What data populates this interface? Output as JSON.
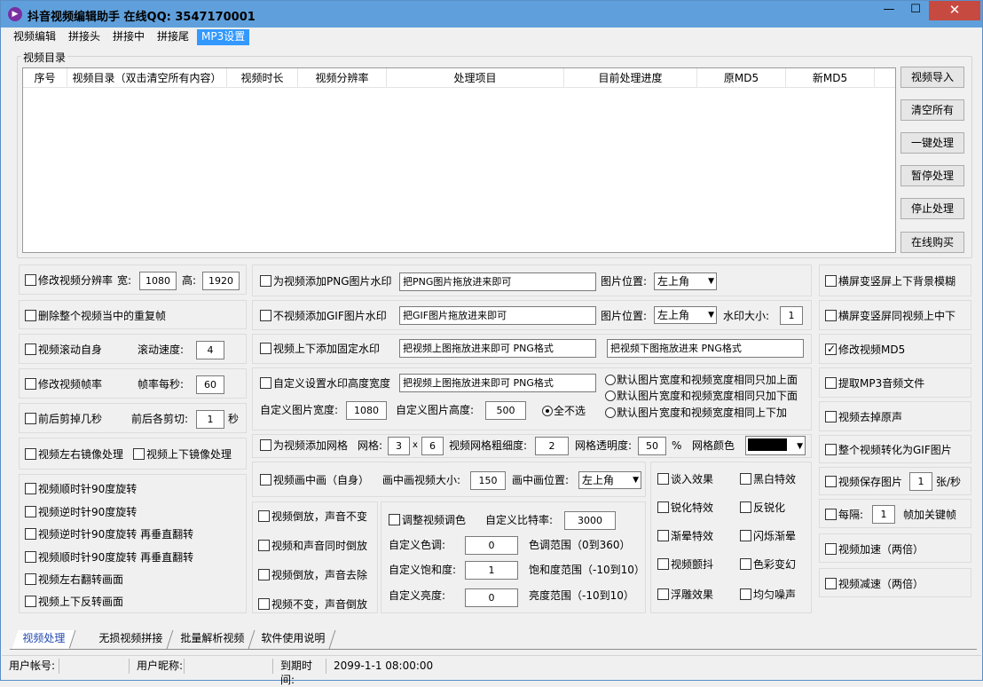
{
  "window": {
    "title": "抖音视频编辑助手  在线QQ: 3547170001",
    "icon": "play-icon",
    "min": "—",
    "max": "☐",
    "close": "✕"
  },
  "menu": [
    "视频编辑",
    "拼接头",
    "拼接中",
    "拼接尾",
    "MP3设置"
  ],
  "video_list": {
    "group_title": "视频目录",
    "columns": [
      "序号",
      "视频目录（双击清空所有内容）",
      "视频时长",
      "视频分辨率",
      "处理项目",
      "目前处理进度",
      "原MD5",
      "新MD5"
    ]
  },
  "side_buttons": [
    "视频导入",
    "清空所有",
    "一键处理",
    "暂停处理",
    "停止处理",
    "在线购买"
  ],
  "left": {
    "resolution": {
      "label": "修改视频分辨率",
      "w_label": "宽:",
      "w": "1080",
      "h_label": "高:",
      "h": "1920"
    },
    "dedupe": "删除整个视频当中的重复帧",
    "scroll": {
      "label": "视频滚动自身",
      "speed_label": "滚动速度:",
      "speed": "4"
    },
    "fps": {
      "label": "修改视频帧率",
      "per_label": "帧率每秒:",
      "value": "60"
    },
    "trim": {
      "label": "前后剪掉几秒",
      "each_label": "前后各剪切:",
      "value": "1",
      "unit": "秒"
    },
    "mirror_lr": "视频左右镜像处理",
    "mirror_ud": "视频上下镜像处理",
    "rotations": [
      "视频顺时针90度旋转",
      "视频逆时针90度旋转",
      "视频逆时针90度旋转 再垂直翻转",
      "视频顺时针90度旋转 再垂直翻转",
      "视频左右翻转画面",
      "视频上下反转画面"
    ]
  },
  "center": {
    "png": {
      "label": "为视频添加PNG图片水印",
      "input": "把PNG图片拖放进来即可",
      "pos_label": "图片位置:",
      "pos": "左上角"
    },
    "gif": {
      "label": "不视频添加GIF图片水印",
      "input": "把GIF图片拖放进来即可",
      "pos_label": "图片位置:",
      "pos": "左上角",
      "size_label": "水印大小:",
      "size": "1"
    },
    "updown": {
      "label": "视频上下添加固定水印",
      "top": "把视频上图拖放进来即可 PNG格式",
      "bottom": "把视频下图拖放进来  PNG格式"
    },
    "custom": {
      "label": "自定义设置水印高度宽度",
      "input": "把视频上图拖放进来即可 PNG格式",
      "w_label": "自定义图片宽度:",
      "w": "1080",
      "h_label": "自定义图片高度:",
      "h": "500",
      "none": "全不选",
      "radios": [
        "默认图片宽度和视频宽度相同只加上面",
        "默认图片宽度和视频宽度相同只加下面",
        "默认图片宽度和视频宽度相同上下加"
      ]
    },
    "grid": {
      "label": "为视频添加网格",
      "grid_label": "网格:",
      "a": "3",
      "x": "x",
      "b": "6",
      "thick_label": "视频网格粗细度:",
      "thick": "2",
      "alpha_label": "网格透明度:",
      "alpha": "50",
      "pct": "%",
      "color_label": "网格颜色",
      "color": "#000000"
    },
    "pip": {
      "label": "视频画中画（自身）",
      "size_label": "画中画视频大小:",
      "size": "150",
      "pos_label": "画中画位置:",
      "pos": "左上角"
    },
    "reverse": [
      "视频倒放，声音不变",
      "视频和声音同时倒放",
      "视频倒放，声音去除",
      "视频不变，声音倒放"
    ],
    "color": {
      "label": "调整视频调色",
      "bitrate_label": "自定义比特率:",
      "bitrate": "3000",
      "hue_label": "自定义色调:",
      "hue": "0",
      "hue_range": "色调范围（0到360）",
      "sat_label": "自定义饱和度:",
      "sat": "1",
      "sat_range": "饱和度范围（-10到10）",
      "bri_label": "自定义亮度:",
      "bri": "0",
      "bri_range": "亮度范围（-10到10）"
    },
    "effects_left": [
      "谈入效果",
      "锐化特效",
      "渐晕特效",
      "视频颤抖",
      "浮雕效果"
    ],
    "effects_right": [
      "黑白特效",
      "反锐化",
      "闪烁渐晕",
      "色彩变幻",
      "均匀噪声"
    ]
  },
  "right": {
    "blur_bg": "横屏变竖屏上下背景模糊",
    "same_ud": "横屏变竖屏同视频上中下",
    "md5": "修改视频MD5",
    "mp3": "提取MP3音频文件",
    "mute": "视频去掉原声",
    "gif": "整个视频转化为GIF图片",
    "save": {
      "label": "视频保存图片",
      "value": "1",
      "unit": "张/秒"
    },
    "every": {
      "label": "每隔:",
      "value": "1",
      "unit": "帧加关键帧"
    },
    "fast": "视频加速（两倍）",
    "slow": "视频减速（两倍）"
  },
  "tabs": [
    "视频处理",
    "无损视频拼接",
    "批量解析视频",
    "软件使用说明"
  ],
  "status": {
    "account_label": "用户帐号:",
    "account": "",
    "nick_label": "用户昵称:",
    "nick": "",
    "expire_label": "到期时间:",
    "expire": "2099-1-1 08:00:00"
  }
}
